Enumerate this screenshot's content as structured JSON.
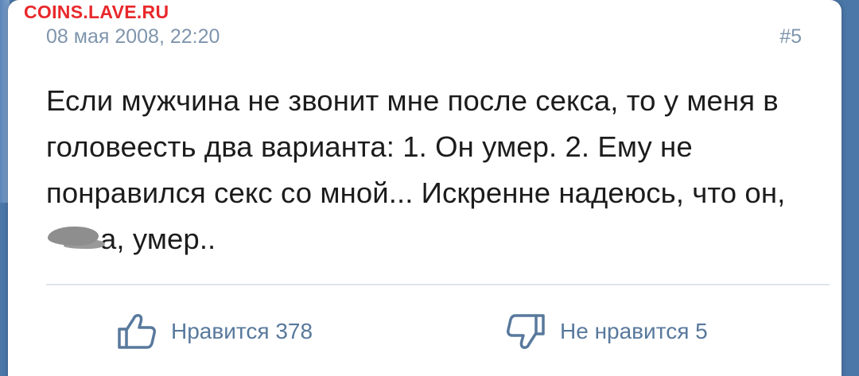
{
  "watermark": "COINS.LAVE.RU",
  "post": {
    "date": "08 мая 2008, 22:20",
    "number": "#5",
    "text_part1": "Если мужчина не звонит мне после секса, то у меня в головеесть два варианта: 1. Он умер. 2. Ему не понравился секс со мной... Искренне надеюсь, что он,",
    "text_part2": "а, умер.."
  },
  "actions": {
    "like_label": "Нравится 378",
    "dislike_label": "Не нравится 5"
  },
  "colors": {
    "background": "#4a76a8",
    "meta_text": "#7f95ad",
    "action_text": "#58799c",
    "watermark": "#e8282b"
  }
}
